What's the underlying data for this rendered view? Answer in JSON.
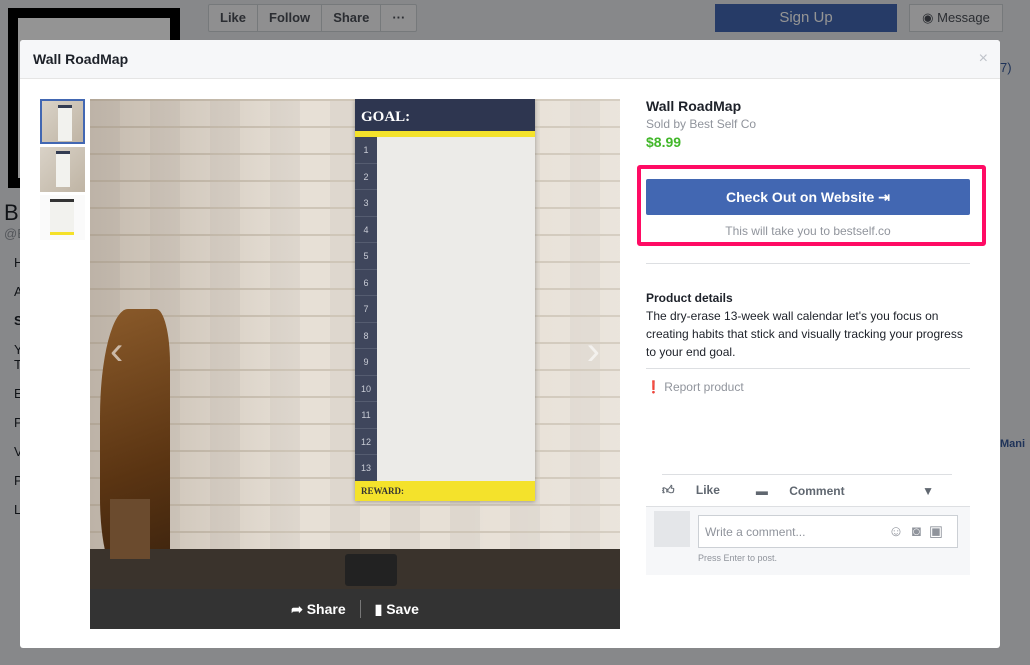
{
  "background": {
    "page_actions": [
      "Like",
      "Follow",
      "Share",
      "···"
    ],
    "signup_label": "Sign Up",
    "message_label": "Message",
    "profile_fragments": [
      "B",
      "@B",
      "H",
      "A",
      "S",
      "Y",
      "T",
      "E",
      "P",
      "V",
      "P",
      "L"
    ],
    "right_fragments": [
      "7)",
      "Mani"
    ]
  },
  "modal": {
    "title": "Wall RoadMap",
    "close": "×",
    "photo": {
      "poster_header": "GOAL:",
      "poster_numbers": [
        "1",
        "2",
        "3",
        "4",
        "5",
        "6",
        "7",
        "8",
        "9",
        "10",
        "11",
        "12",
        "13"
      ],
      "poster_footer": "REWARD:",
      "share_label": "Share",
      "save_label": "Save",
      "prev_arrow": "‹",
      "next_arrow": "›"
    },
    "product": {
      "name": "Wall RoadMap",
      "seller": "Sold by Best Self Co",
      "price": "$8.99",
      "checkout_label": "Check Out on Website",
      "checkout_note": "This will take you to bestself.co",
      "details_heading": "Product details",
      "details_text": "The dry-erase 13-week wall calendar let's you focus on creating habits that stick and visually tracking your progress to your end goal.",
      "report_label": "Report product"
    },
    "engagement": {
      "like_label": "Like",
      "comment_label": "Comment",
      "comment_placeholder": "Write a comment...",
      "hint": "Press Enter to post."
    }
  },
  "colors": {
    "accent": "#4267b2",
    "price": "#42b72a",
    "highlight": "#ff0b64"
  }
}
